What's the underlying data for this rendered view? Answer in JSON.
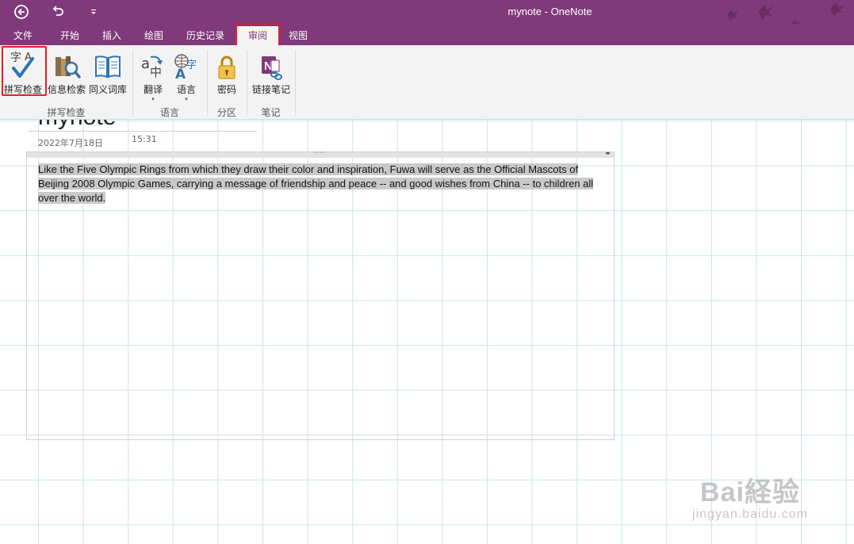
{
  "window": {
    "title": "mynote - OneNote"
  },
  "tabs": [
    {
      "label": "文件"
    },
    {
      "label": "开始"
    },
    {
      "label": "插入"
    },
    {
      "label": "绘图"
    },
    {
      "label": "历史记录"
    },
    {
      "label": "审阅",
      "active": true
    },
    {
      "label": "视图"
    }
  ],
  "ribbon": {
    "spelling": {
      "label": "拼写检查"
    },
    "research": {
      "label": "信息检索"
    },
    "thesaurus": {
      "label": "同义词库"
    },
    "translate": {
      "label": "翻译"
    },
    "language": {
      "label": "语言"
    },
    "password": {
      "label": "密码"
    },
    "linked_notes": {
      "label": "链接笔记"
    },
    "groups": {
      "proofing": "拼写检查",
      "language": "语言",
      "section": "分区",
      "notes": "笔记"
    }
  },
  "page": {
    "title": "mynote",
    "date": "2022年7月18日",
    "time": "15:31",
    "text_line1": "Like the Five Olympic Rings from which they draw their color and inspiration, Fuwa will serve as the Official Mascots of",
    "text_line2": "Beijing 2008 Olympic Games, carrying a message of friendship and peace -- and good wishes from China -- to children all",
    "text_line3": "over the world."
  },
  "watermark": {
    "main": "Bai経验",
    "sub": "jingyan.baidu.com"
  },
  "colors": {
    "accent": "#80397B",
    "highlight": "#E02020",
    "selection": "#C9C9C9"
  }
}
